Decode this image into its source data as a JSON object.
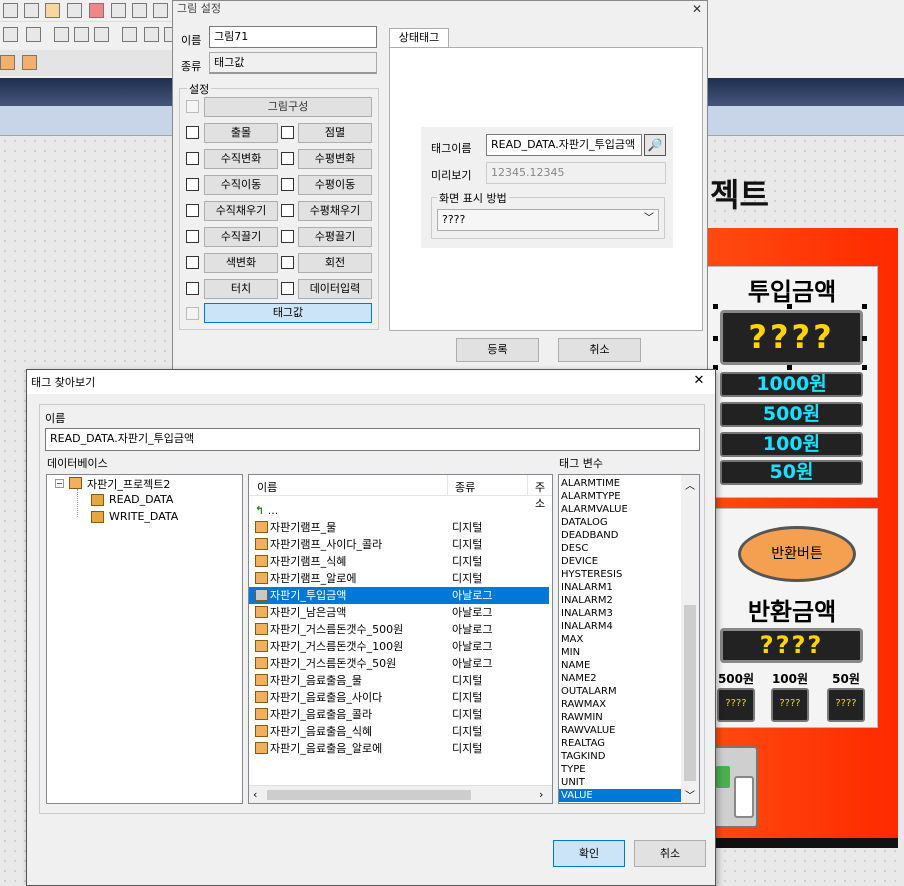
{
  "dialog_settings": {
    "title": "그림 설정",
    "close_glyph": "✕",
    "name_label": "이름",
    "name_value": "그림71",
    "type_label": "종류",
    "type_value": "태그값",
    "settings_group": "설정",
    "compose_button": "그림구성",
    "options": [
      {
        "left": "출몰",
        "right": "점멸"
      },
      {
        "left": "수직변화",
        "right": "수평변화"
      },
      {
        "left": "수직이동",
        "right": "수평이동"
      },
      {
        "left": "수직채우기",
        "right": "수평채우기"
      },
      {
        "left": "수직끌기",
        "right": "수평끌기"
      },
      {
        "left": "색변화",
        "right": "회전"
      },
      {
        "left": "터치",
        "right": "데이터입력"
      }
    ],
    "tag_value_button": "태그값",
    "tab_label": "상태태그",
    "tag_name_label": "태그이름",
    "tag_name_value": "READ_DATA.자판기_투입금액",
    "preview_label": "미리보기",
    "preview_value": "12345.12345",
    "display_method_group": "화면 표시 방법",
    "display_method_value": "????",
    "register_button": "등록",
    "cancel_button": "취소"
  },
  "dialog_tagbrowser": {
    "title": "태그 찾아보기",
    "close_glyph": "✕",
    "name_group": "이름",
    "name_value": "READ_DATA.자판기_투입금액",
    "db_label": "데이터베이스",
    "tree_root": "자판기_프로젝트2",
    "tree_children": [
      "READ_DATA",
      "WRITE_DATA"
    ],
    "list_headers": [
      "이름",
      "종류",
      "주소"
    ],
    "parent_row": "...",
    "list_rows": [
      {
        "name": "자판기램프_물",
        "kind": "디지털"
      },
      {
        "name": "자판기램프_사이다_콜라",
        "kind": "디지털"
      },
      {
        "name": "자판기램프_식혜",
        "kind": "디지털"
      },
      {
        "name": "자판기램프_알로에",
        "kind": "디지털"
      },
      {
        "name": "자판기_투입금액",
        "kind": "아날로그"
      },
      {
        "name": "자판기_남은금액",
        "kind": "아날로그"
      },
      {
        "name": "자판기_거스름돈갯수_500원",
        "kind": "아날로그"
      },
      {
        "name": "자판기_거스름돈갯수_100원",
        "kind": "아날로그"
      },
      {
        "name": "자판기_거스름돈갯수_50원",
        "kind": "아날로그"
      },
      {
        "name": "자판기_음료출음_물",
        "kind": "디지털"
      },
      {
        "name": "자판기_음료출음_사이다",
        "kind": "디지털"
      },
      {
        "name": "자판기_음료출음_콜라",
        "kind": "디지털"
      },
      {
        "name": "자판기_음료출음_식혜",
        "kind": "디지털"
      },
      {
        "name": "자판기_음료출음_알로에",
        "kind": "디지털"
      }
    ],
    "selected_row_index": 4,
    "tag_var_label": "태그 변수",
    "tag_vars": [
      "ALARMTIME",
      "ALARMTYPE",
      "ALARMVALUE",
      "DATALOG",
      "DEADBAND",
      "DESC",
      "DEVICE",
      "HYSTERESIS",
      "INALARM1",
      "INALARM2",
      "INALARM3",
      "INALARM4",
      "MAX",
      "MIN",
      "NAME",
      "NAME2",
      "OUTALARM",
      "RAWMAX",
      "RAWMIN",
      "RAWVALUE",
      "REALTAG",
      "TAGKIND",
      "TYPE",
      "UNIT",
      "VALUE"
    ],
    "selected_tag_var": "VALUE",
    "ok_button": "확인",
    "cancel_button": "취소"
  },
  "background": {
    "project_title_fragment": "젝트",
    "insert_amount_label": "투입금액",
    "insert_display": "????",
    "coin_buttons": [
      "1000원",
      "500원",
      "100원",
      "50원"
    ],
    "return_button": "반환버튼",
    "return_amount_label": "반환금액",
    "return_display": "????",
    "change_labels": [
      "500원",
      "100원",
      "50원"
    ],
    "change_displays": [
      "????",
      "????",
      "????"
    ]
  },
  "colors": {
    "selection": "#0078d7",
    "red_panel": "#ff3300",
    "display_yellow": "#ffd400",
    "display_cyan": "#19e0ff",
    "orange_button": "#f5a050"
  }
}
